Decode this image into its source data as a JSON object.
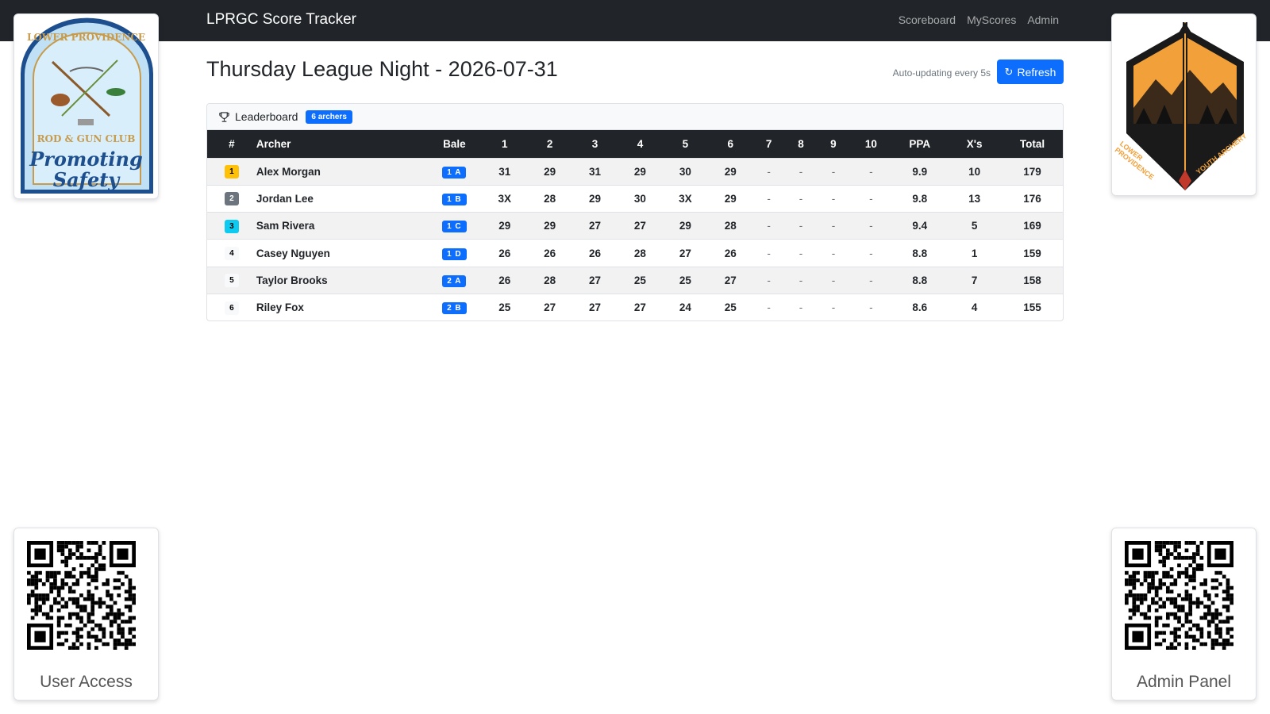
{
  "navbar": {
    "brand": "LPRGC Score Tracker",
    "links": [
      "Scoreboard",
      "MyScores",
      "Admin"
    ]
  },
  "logos": {
    "left": {
      "lines": [
        "LOWER PROVIDENCE",
        "ROD & GUN CLUB",
        "Promoting",
        "Safety"
      ]
    },
    "right": {
      "lines": [
        "LOWER PROVIDENCE",
        "YOUTH ARCHERY"
      ]
    }
  },
  "header": {
    "title": "Thursday League Night - 2026-07-31",
    "auto_update": "Auto-updating every 5s",
    "refresh_label": "Refresh"
  },
  "leaderboard": {
    "title": "Leaderboard",
    "count_badge": "6 archers",
    "columns": [
      "#",
      "Archer",
      "Bale",
      "1",
      "2",
      "3",
      "4",
      "5",
      "6",
      "7",
      "8",
      "9",
      "10",
      "PPA",
      "X's",
      "Total"
    ],
    "rows": [
      {
        "rank": "1",
        "rank_bg": "#ffc107",
        "rank_fg": "#000000",
        "name": "Alex Morgan",
        "bale": "1 A",
        "ends": [
          "31",
          "29",
          "31",
          "29",
          "30",
          "29",
          "-",
          "-",
          "-",
          "-"
        ],
        "ppa": "9.9",
        "xs": "10",
        "total": "179"
      },
      {
        "rank": "2",
        "rank_bg": "#6c757d",
        "rank_fg": "#ffffff",
        "name": "Jordan Lee",
        "bale": "1 B",
        "ends": [
          "3X",
          "28",
          "29",
          "30",
          "3X",
          "29",
          "-",
          "-",
          "-",
          "-"
        ],
        "ppa": "9.8",
        "xs": "13",
        "total": "176"
      },
      {
        "rank": "3",
        "rank_bg": "#0dcaf0",
        "rank_fg": "#000000",
        "name": "Sam Rivera",
        "bale": "1 C",
        "ends": [
          "29",
          "29",
          "27",
          "27",
          "29",
          "28",
          "-",
          "-",
          "-",
          "-"
        ],
        "ppa": "9.4",
        "xs": "5",
        "total": "169"
      },
      {
        "rank": "4",
        "rank_bg": "#f8f9fa",
        "rank_fg": "#000000",
        "name": "Casey Nguyen",
        "bale": "1 D",
        "ends": [
          "26",
          "26",
          "26",
          "28",
          "27",
          "26",
          "-",
          "-",
          "-",
          "-"
        ],
        "ppa": "8.8",
        "xs": "1",
        "total": "159"
      },
      {
        "rank": "5",
        "rank_bg": "#f8f9fa",
        "rank_fg": "#000000",
        "name": "Taylor Brooks",
        "bale": "2 A",
        "ends": [
          "26",
          "28",
          "27",
          "25",
          "25",
          "27",
          "-",
          "-",
          "-",
          "-"
        ],
        "ppa": "8.8",
        "xs": "7",
        "total": "158"
      },
      {
        "rank": "6",
        "rank_bg": "#f8f9fa",
        "rank_fg": "#000000",
        "name": "Riley Fox",
        "bale": "2 B",
        "ends": [
          "25",
          "27",
          "27",
          "27",
          "24",
          "25",
          "-",
          "-",
          "-",
          "-"
        ],
        "ppa": "8.6",
        "xs": "4",
        "total": "155"
      }
    ]
  },
  "qr": {
    "user_caption": "User Access",
    "admin_caption": "Admin Panel"
  },
  "colors": {
    "navbar": "#212529",
    "primary": "#0d6efd",
    "gold": "#ffc107",
    "silver": "#6c757d",
    "bronze": "#0dcaf0"
  }
}
